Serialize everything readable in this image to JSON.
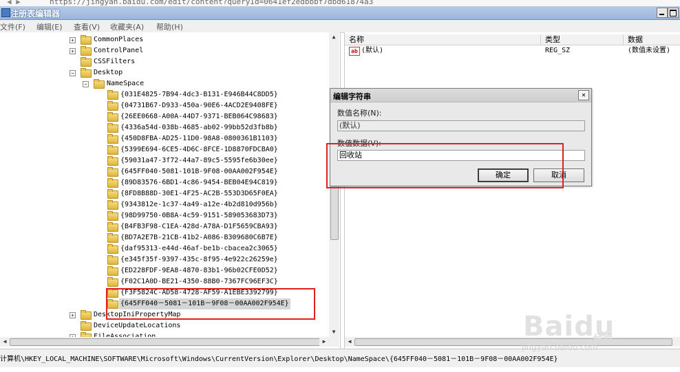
{
  "browser": {
    "url": "https://jingyan.baidu.com/edit/content?queryId=0641ef2edbbbf7dbd61874a3"
  },
  "window": {
    "title": "注册表编辑器"
  },
  "menu": [
    "文件(F)",
    "编辑(E)",
    "查看(V)",
    "收藏夹(A)",
    "帮助(H)"
  ],
  "tree": {
    "top_items": [
      "CommonPlaces",
      "ControlPanel",
      "CSSFilters"
    ],
    "desktop": "Desktop",
    "namespace": "NameSpace",
    "guids": [
      "{031E4825-7B94-4dc3-B131-E946B44C8DD5}",
      "{04731B67-D933-450a-90E6-4ACD2E9408FE}",
      "{26EE0668-A00A-44D7-9371-BEB064C98683}",
      "{4336a54d-038b-4685-ab02-99bb52d3fb8b}",
      "{450D8FBA-AD25-11D0-98A8-0800361B1103}",
      "{5399E694-6CE5-4D6C-8FCE-1D8870FDCBA0}",
      "{59031a47-3f72-44a7-89c5-5595fe6b30ee}",
      "{645FF040-5081-101B-9F08-00AA002F954E}",
      "{89D83576-6BD1-4c86-9454-BEB04E94C819}",
      "{8FD8B88D-30E1-4F25-AC2B-553D3D65F0EA}",
      "{9343812e-1c37-4a49-a12e-4b2d810d956b}",
      "{98D99750-0B8A-4c59-9151-589053683D73}",
      "{B4FB3F98-C1EA-428d-A78A-D1F5659CBA93}",
      "{BD7A2E7B-21CB-41b2-A086-B309680C6B7E}",
      "{daf95313-e44d-46af-be1b-cbacea2c3065}",
      "{e345f35f-9397-435c-8f95-4e922c26259e}",
      "{ED228FDF-9EA8-4870-83b1-96b02CFE0D52}",
      "{F02C1A0D-BE21-4350-88B0-7367FC96EF3C}",
      "{F3F5824C-AD58-4728-AF59-A1EBE3392799}",
      "{645FF040－5081－101B－9F08－00AA002F954E}"
    ],
    "after_items": [
      "DesktopIniPropertyMap",
      "DeviceUpdateLocations",
      "FileAssociation"
    ]
  },
  "list": {
    "columns": [
      "名称",
      "类型",
      "数据"
    ],
    "rows": [
      {
        "name": "(默认)",
        "type": "REG_SZ",
        "data": "(数值未设置)"
      }
    ]
  },
  "dialog": {
    "title": "编辑字符串",
    "name_label": "数值名称(N):",
    "name_value": "(默认)",
    "data_label": "数值数据(V):",
    "data_value": "回收站",
    "ok": "确定",
    "cancel": "取消"
  },
  "status": {
    "path": "计算机\\HKEY_LOCAL_MACHINE\\SOFTWARE\\Microsoft\\Windows\\CurrentVersion\\Explorer\\Desktop\\NameSpace\\{645FF040－5081－101B－9F08－00AA002F954E}"
  },
  "watermark": {
    "logo": "Baidu",
    "logo_sub": "经验",
    "site": "jingyan.baidu.com"
  },
  "colors": {
    "highlight": "#e02020",
    "title_bar": "#9ab6dc",
    "folder": "#e0b53a"
  }
}
